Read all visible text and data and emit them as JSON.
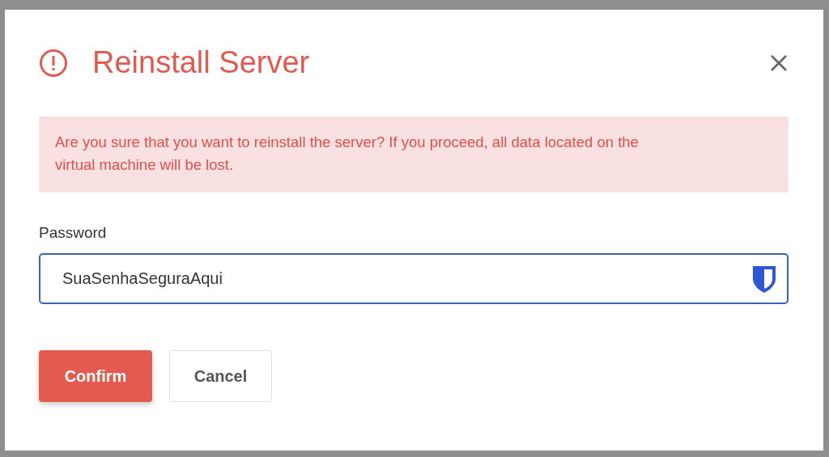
{
  "modal": {
    "title": "Reinstall Server",
    "alert": "Are you sure that you want to reinstall the server? If you proceed, all data located on the virtual machine will be lost.",
    "password": {
      "label": "Password",
      "value": "SuaSenhaSeguraAqui"
    },
    "buttons": [
      {
        "label": "Confirm",
        "kind": "primary"
      },
      {
        "label": "Cancel",
        "kind": "secondary"
      }
    ]
  }
}
